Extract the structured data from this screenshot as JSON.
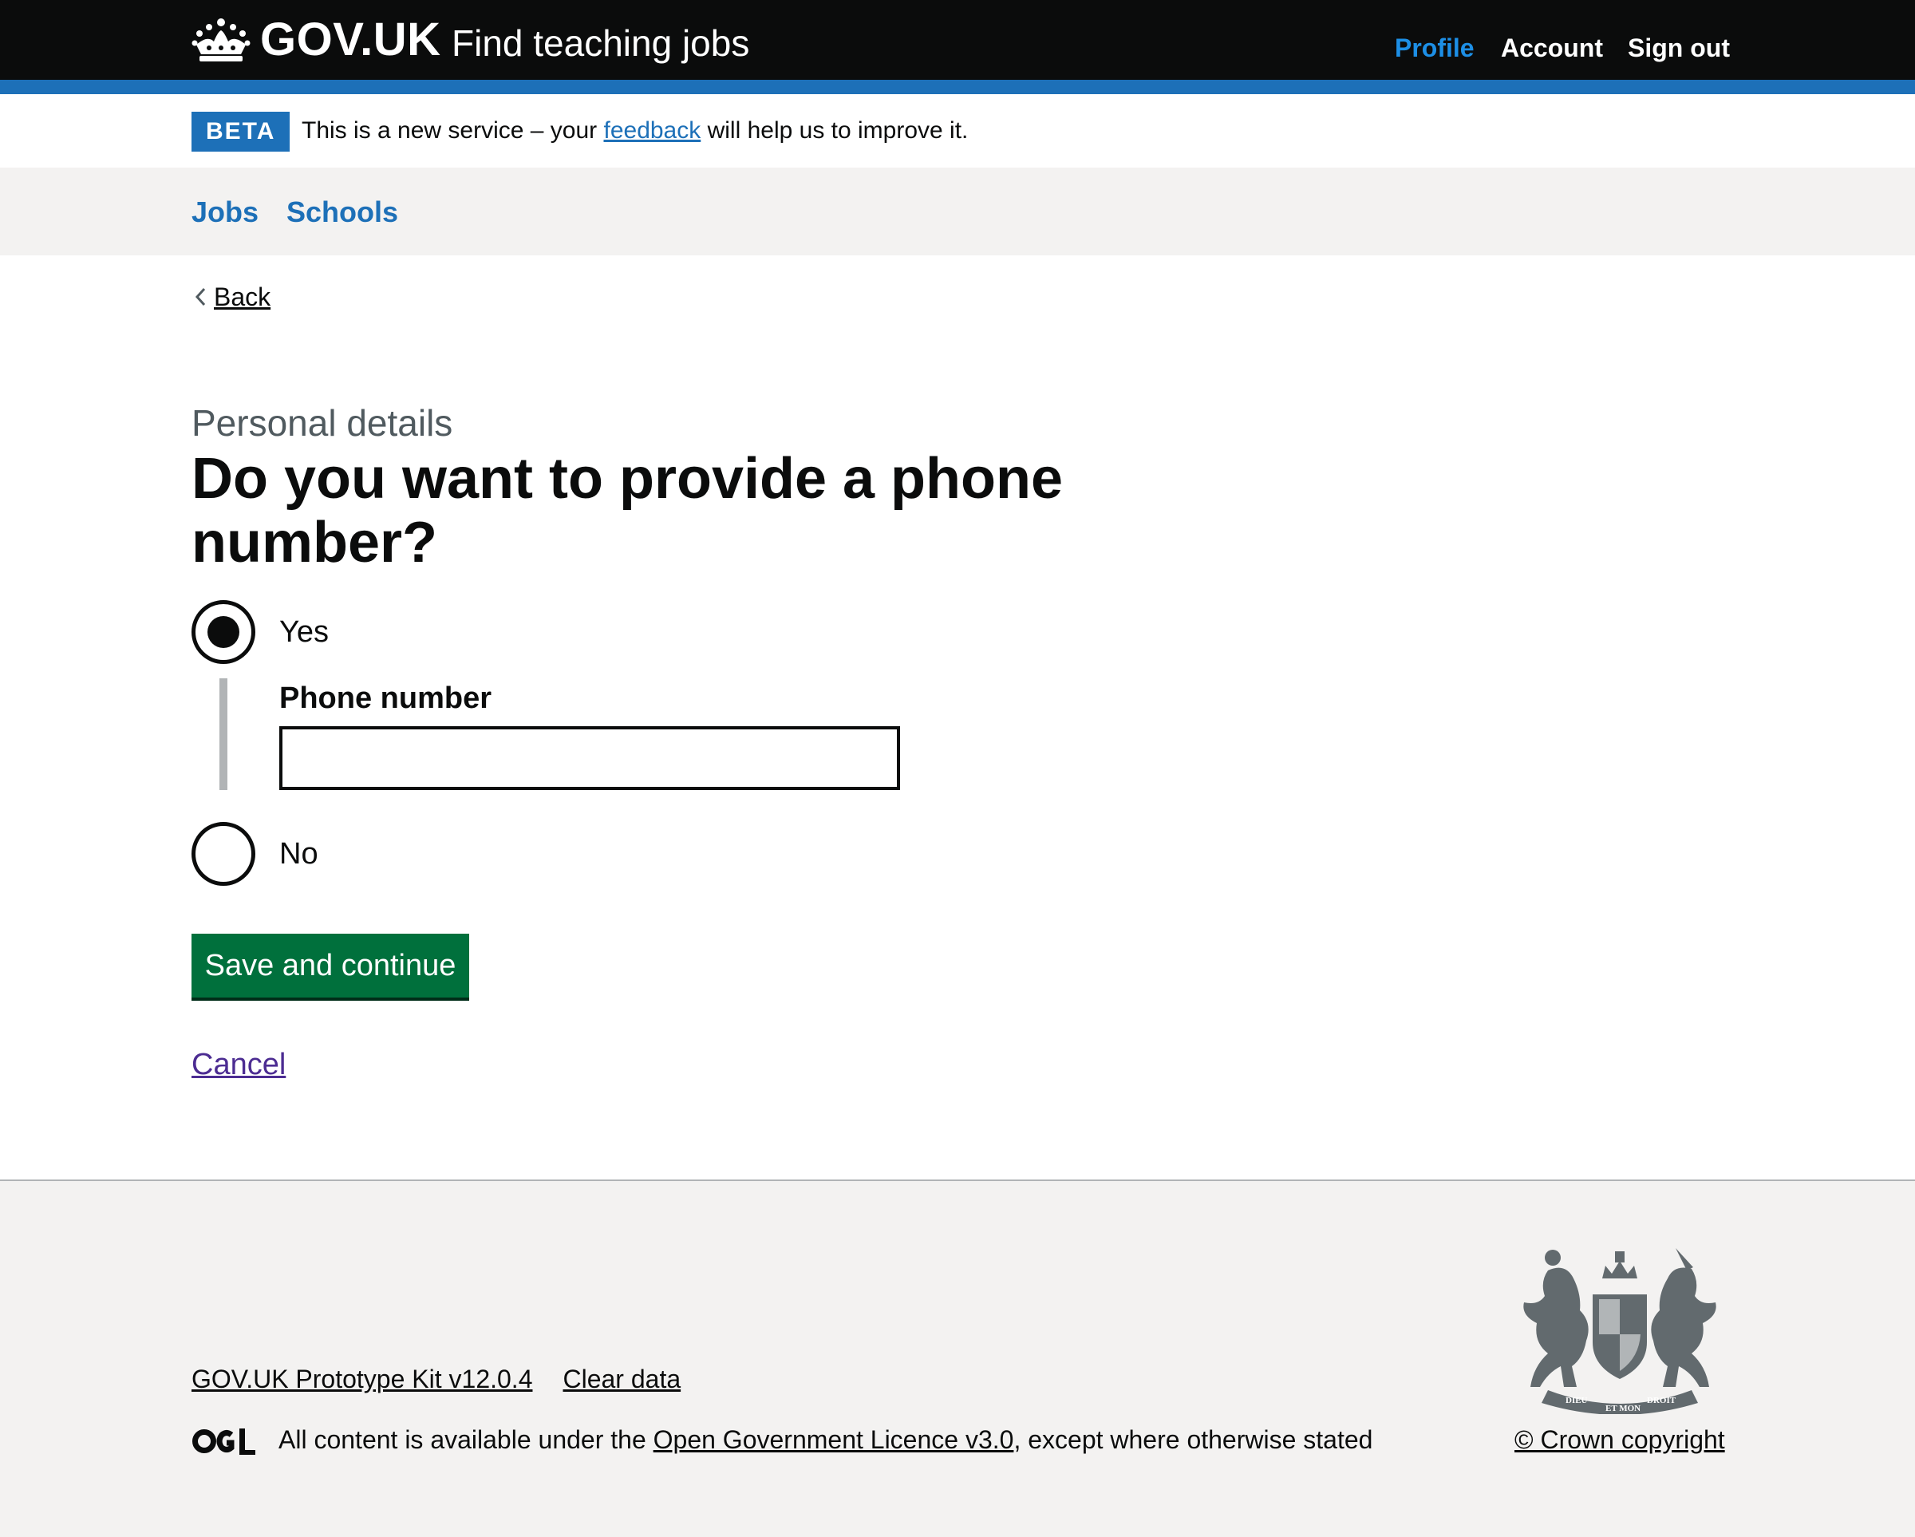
{
  "header": {
    "logo_text": "GOV.UK",
    "service_name": "Find teaching jobs",
    "nav": [
      {
        "label": "Profile",
        "active": true
      },
      {
        "label": "Account",
        "active": false
      },
      {
        "label": "Sign out",
        "active": false
      }
    ]
  },
  "beta": {
    "tag": "BETA",
    "text_before": "This is a new service – your ",
    "link": "feedback",
    "text_after": " will help us to improve it."
  },
  "subnav": {
    "items": [
      "Jobs",
      "Schools"
    ]
  },
  "back_link": "Back",
  "form": {
    "caption": "Personal details",
    "heading": "Do you want to provide a phone number?",
    "options": [
      {
        "label": "Yes",
        "selected": true
      },
      {
        "label": "No",
        "selected": false
      }
    ],
    "conditional_label": "Phone number",
    "phone_value": "",
    "submit_label": "Save and continue",
    "cancel_label": "Cancel"
  },
  "footer": {
    "links": [
      "GOV.UK Prototype Kit v12.0.4",
      "Clear data"
    ],
    "licence_before": "All content is available under the ",
    "licence_link": "Open Government Licence v3.0",
    "licence_after": ", except where otherwise stated",
    "copyright": "© Crown copyright",
    "crest_motto": [
      "DIEU",
      "ET MON",
      "DROIT"
    ]
  },
  "colors": {
    "header_bg": "#0b0c0c",
    "brand_blue": "#1d70b8",
    "profile_link": "#1d8fe6",
    "button_green": "#00703c",
    "visited_link": "#4c2c92",
    "footer_bg": "#f3f2f1"
  }
}
